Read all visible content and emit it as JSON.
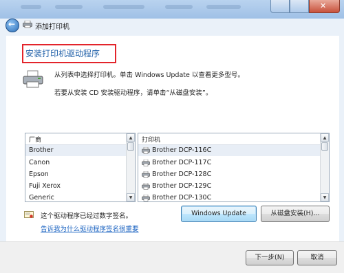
{
  "window": {
    "nav_title": "添加打印机"
  },
  "page": {
    "heading": "安装打印机驱动程序",
    "instruction_1": "从列表中选择打印机。单击 Windows Update 以查看更多型号。",
    "instruction_2": "若要从安装 CD 安装驱动程序，请单击“从磁盘安装”。"
  },
  "manufacturers": {
    "header": "厂商",
    "items": [
      "Brother",
      "Canon",
      "Epson",
      "Fuji Xerox",
      "Generic"
    ],
    "selected_index": 0
  },
  "printers": {
    "header": "打印机",
    "items": [
      "Brother DCP-116C",
      "Brother DCP-117C",
      "Brother DCP-128C",
      "Brother DCP-129C",
      "Brother DCP-130C"
    ],
    "selected_index": 0
  },
  "signature": {
    "status": "这个驱动程序已经过数字签名。",
    "link": "告诉我为什么驱动程序签名很重要"
  },
  "buttons": {
    "windows_update": "Windows Update",
    "have_disk": "从磁盘安装(H)...",
    "next": "下一步(N)",
    "cancel": "取消"
  },
  "icons": {
    "back": "back-arrow-icon",
    "printer": "printer-icon",
    "certificate": "certificate-icon"
  },
  "colors": {
    "heading_text": "#1f5fa8",
    "heading_highlight_border": "#e3242b",
    "link": "#1c64c2"
  }
}
